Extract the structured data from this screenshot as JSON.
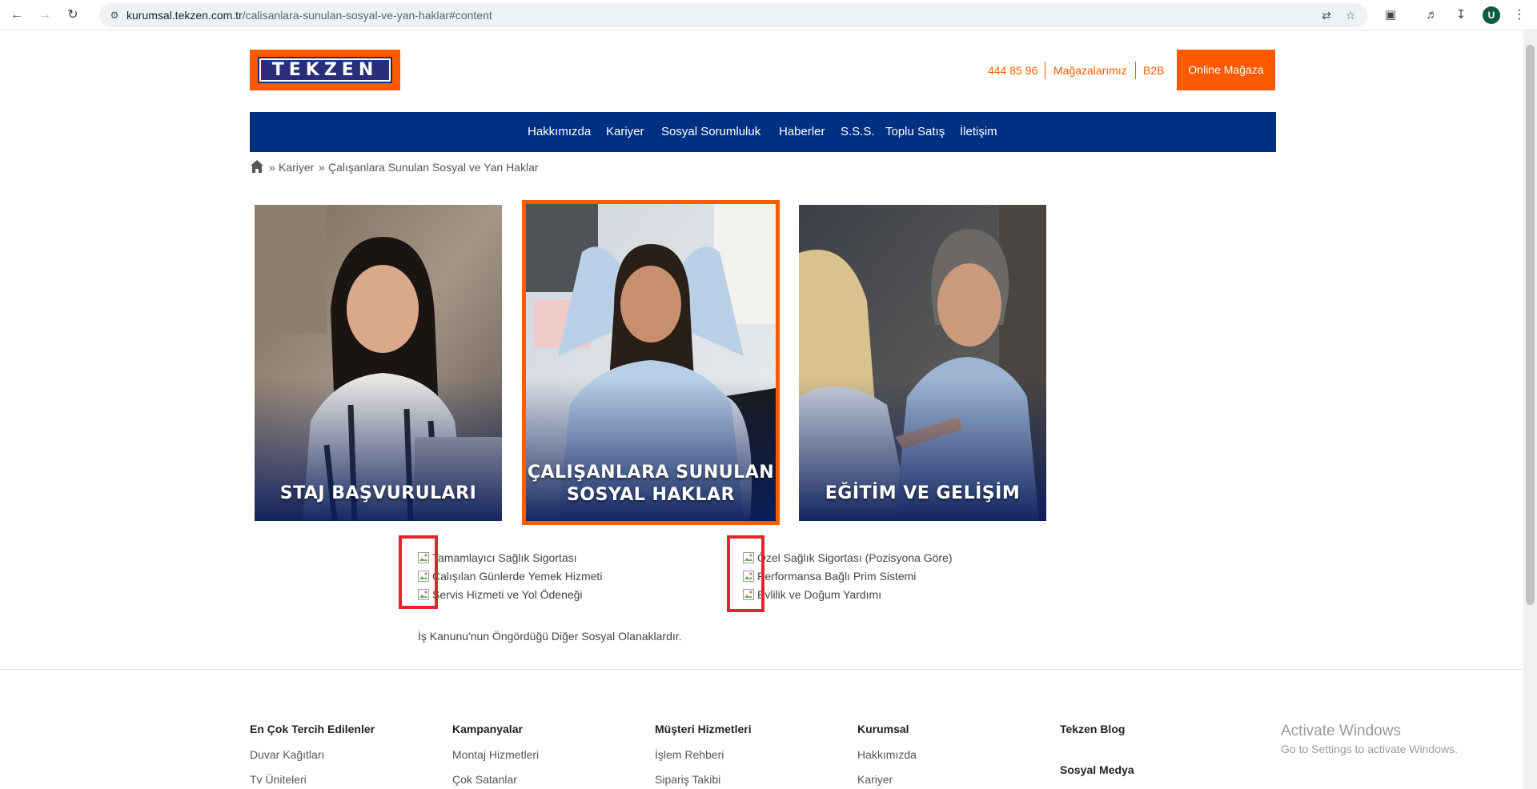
{
  "browser": {
    "url_host": "kurumsal.tekzen.com.tr",
    "url_path": "/calisanlara-sunulan-sosyal-ve-yan-haklar#content",
    "profile_initial": "U"
  },
  "header": {
    "logo_text": "TEKZEN",
    "phone": "444 85 96",
    "stores": "Mağazalarımız",
    "b2b": "B2B",
    "online_store": "Online Mağaza"
  },
  "nav": {
    "items": [
      "Hakkımızda",
      "Kariyer",
      "Sosyal Sorumluluk",
      "Haberler",
      "S.S.S.",
      "Toplu Satış",
      "İletişim"
    ]
  },
  "breadcrumb": {
    "sep": "»",
    "items": [
      "Kariyer",
      "Çalışanlara Sunulan Sosyal ve Yan Haklar"
    ]
  },
  "cards": [
    {
      "title_line1": "STAJ BAŞVURULARI",
      "title_line2": ""
    },
    {
      "title_line1": "ÇALIŞANLARA SUNULAN",
      "title_line2": "SOSYAL HAKLAR"
    },
    {
      "title_line1": "EĞİTİM VE GELİŞİM",
      "title_line2": ""
    }
  ],
  "benefits": {
    "left": [
      "Tamamlayıcı Sağlık Sigortası",
      "Çalışılan Günlerde Yemek Hizmeti",
      "Servis Hizmeti ve Yol Ödeneği"
    ],
    "right": [
      "Özel Sağlık Sigortası (Pozisyona Göre)",
      "Performansa Bağlı Prim Sistemi",
      "Evlilik ve Doğum Yardımı"
    ],
    "note": "İş Kanunu'nun Öngördüğü Diğer Sosyal Olanaklardır."
  },
  "footer": {
    "columns": [
      {
        "title": "En Çok Tercih Edilenler",
        "links": [
          "Duvar Kağıtları",
          "Tv Üniteleri"
        ]
      },
      {
        "title": "Kampanyalar",
        "links": [
          "Montaj Hizmetleri",
          "Çok Satanlar"
        ]
      },
      {
        "title": "Müşteri Hizmetleri",
        "links": [
          "İşlem Rehberi",
          "Sipariş Takibi"
        ]
      },
      {
        "title": "Kurumsal",
        "links": [
          "Hakkımızda",
          "Kariyer"
        ]
      },
      {
        "title": "Tekzen Blog",
        "links": []
      }
    ],
    "social_title": "Sosyal Medya"
  },
  "watermark": {
    "line1": "Activate Windows",
    "line2": "Go to Settings to activate Windows."
  },
  "colors": {
    "brand_orange": "#ff5a00",
    "nav_blue": "#003082",
    "highlight_red": "#e3252b"
  }
}
